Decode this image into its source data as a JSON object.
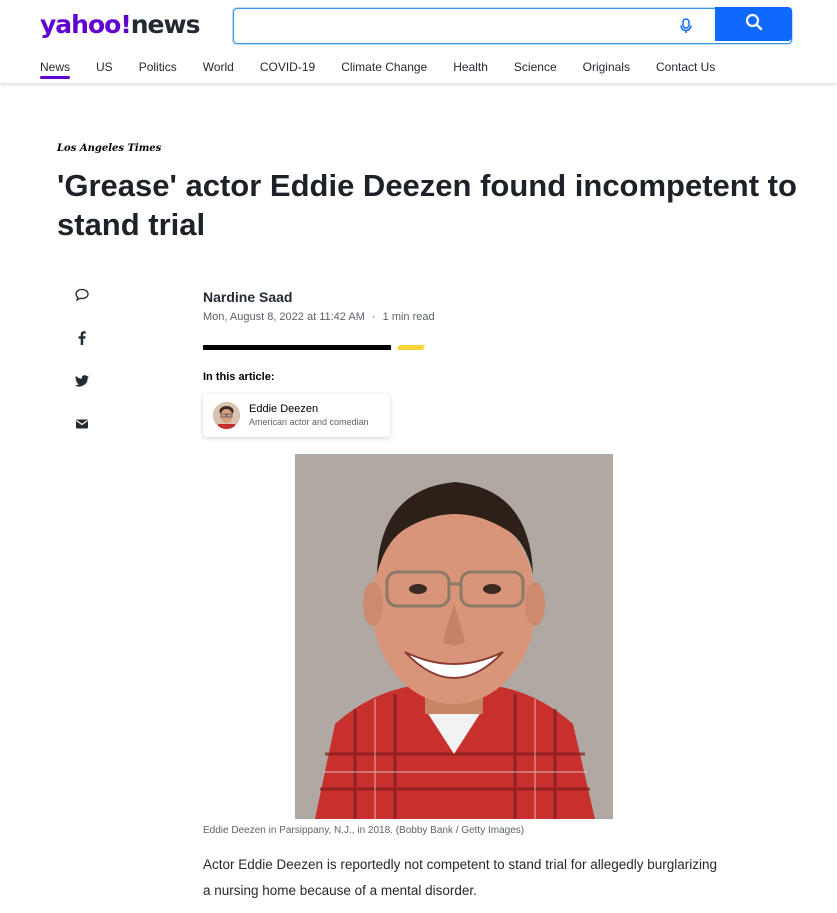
{
  "header": {
    "logo_yahoo": "yahoo!",
    "logo_news": "news",
    "search": {
      "placeholder": "",
      "value": ""
    },
    "nav": [
      "News",
      "US",
      "Politics",
      "World",
      "COVID-19",
      "Climate Change",
      "Health",
      "Science",
      "Originals",
      "Contact Us"
    ],
    "active_nav": "News",
    "accent": "#6001d2",
    "search_button_color": "#0f69ff"
  },
  "article": {
    "source": "Los Angeles Times",
    "headline": "'Grease' actor Eddie Deezen found incompetent to stand trial",
    "author": "Nardine Saad",
    "date": "Mon, August 8, 2022 at 11:42 AM",
    "separator": "·",
    "read_time": "1 min read",
    "in_this_article": "In this article:",
    "entity": {
      "name": "Eddie Deezen",
      "description": "American actor and comedian"
    },
    "caption": "Eddie Deezen in Parsippany, N.J., in 2018. (Bobby Bank / Getty Images)",
    "body": "Actor Eddie Deezen is reportedly not competent to stand trial for allegedly burglarizing a nursing home because of a mental disorder."
  },
  "share_icons": [
    "comment-icon",
    "facebook-icon",
    "twitter-icon",
    "email-icon"
  ]
}
